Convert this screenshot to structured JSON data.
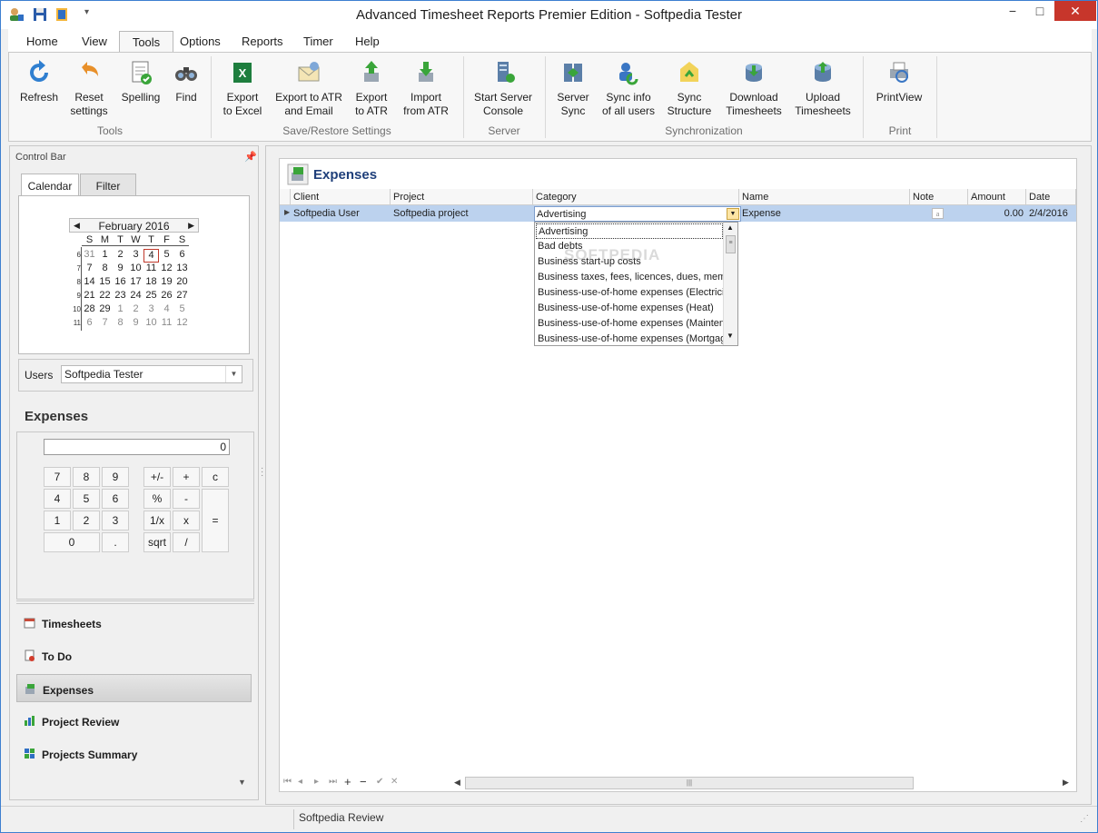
{
  "window": {
    "title": "Advanced Timesheet Reports Premier Edition - Softpedia Tester",
    "minimize": "−",
    "maximize": "□",
    "close": "✕",
    "qat_menu": "▾"
  },
  "menu": {
    "tabs": [
      "Home",
      "View",
      "Tools",
      "Options",
      "Reports",
      "Timer",
      "Help"
    ],
    "active": "Tools"
  },
  "ribbon": {
    "buttons": [
      {
        "id": "refresh",
        "label": "Refresh",
        "icon": "refresh-icon"
      },
      {
        "id": "reset",
        "label": "Reset settings",
        "icon": "undo-icon"
      },
      {
        "id": "spelling",
        "label": "Spelling",
        "icon": "spellcheck-icon"
      },
      {
        "id": "find",
        "label": "Find",
        "icon": "binoculars-icon"
      },
      {
        "id": "export_excel",
        "label": "Export to Excel",
        "icon": "excel-icon"
      },
      {
        "id": "export_atr_email",
        "label": "Export to ATR and Email",
        "icon": "email-icon"
      },
      {
        "id": "export_atr",
        "label": "Export to ATR",
        "icon": "export-icon"
      },
      {
        "id": "import_atr",
        "label": "Import from ATR",
        "icon": "import-icon"
      },
      {
        "id": "start_server",
        "label": "Start Server Console",
        "icon": "server-icon"
      },
      {
        "id": "server_sync",
        "label": "Server Sync",
        "icon": "sync-icon"
      },
      {
        "id": "sync_users",
        "label": "Sync info of all users",
        "icon": "users-sync-icon"
      },
      {
        "id": "sync_structure",
        "label": "Sync Structure",
        "icon": "structure-icon"
      },
      {
        "id": "download_ts",
        "label": "Download Timesheets",
        "icon": "download-icon"
      },
      {
        "id": "upload_ts",
        "label": "Upload Timesheets",
        "icon": "upload-icon"
      },
      {
        "id": "printview",
        "label": "PrintView",
        "icon": "print-preview-icon"
      }
    ],
    "groups": [
      "Tools",
      "Save/Restore Settings",
      "Server",
      "Synchronization",
      "Print"
    ]
  },
  "control_bar": {
    "title": "Control Bar",
    "tabs": [
      "Calendar",
      "Filter"
    ],
    "calendar": {
      "month": "February 2016",
      "dow": [
        "S",
        "M",
        "T",
        "W",
        "T",
        "F",
        "S"
      ],
      "weeks": [
        {
          "wk": "6",
          "days": [
            "31",
            "1",
            "2",
            "3",
            "4",
            "5",
            "6"
          ]
        },
        {
          "wk": "7",
          "days": [
            "7",
            "8",
            "9",
            "10",
            "11",
            "12",
            "13"
          ]
        },
        {
          "wk": "8",
          "days": [
            "14",
            "15",
            "16",
            "17",
            "18",
            "19",
            "20"
          ]
        },
        {
          "wk": "9",
          "days": [
            "21",
            "22",
            "23",
            "24",
            "25",
            "26",
            "27"
          ]
        },
        {
          "wk": "10",
          "days": [
            "28",
            "29",
            "1",
            "2",
            "3",
            "4",
            "5"
          ]
        },
        {
          "wk": "11",
          "days": [
            "6",
            "7",
            "8",
            "9",
            "10",
            "11",
            "12"
          ]
        }
      ],
      "today": "4"
    },
    "users_label": "Users",
    "users_value": "Softpedia Tester",
    "section_title": "Expenses",
    "calc": {
      "display": "0",
      "keys": {
        "k7": "7",
        "k8": "8",
        "k9": "9",
        "k4": "4",
        "k5": "5",
        "k6": "6",
        "k1": "1",
        "k2": "2",
        "k3": "3",
        "k0": "0",
        "kdot": ".",
        "kpm": "+/-",
        "kplus": "+",
        "kc": "c",
        "kpct": "%",
        "kminus": "-",
        "kinv": "1/x",
        "kmul": "x",
        "keq": "=",
        "ksqrt": "sqrt",
        "kdiv": "/"
      }
    },
    "nav": [
      "Timesheets",
      "To Do",
      "Expenses",
      "Project Review",
      "Projects Summary"
    ],
    "nav_active": "Expenses"
  },
  "grid": {
    "title": "Expenses",
    "columns": [
      "Client",
      "Project",
      "Category",
      "Name",
      "Note",
      "Amount",
      "Date"
    ],
    "row": {
      "client": "Softpedia User",
      "project": "Softpedia project",
      "category": "Advertising",
      "name": "Expense",
      "amount": "0.00",
      "date": "2/4/2016"
    },
    "dropdown": [
      "Advertising",
      "Bad debts",
      "Business start-up costs",
      "Business taxes, fees, licences, dues, mem",
      "Business-use-of-home expenses (Electricit",
      "Business-use-of-home expenses (Heat)",
      "Business-use-of-home expenses (Mainten",
      "Business-use-of-home expenses (Mortgag"
    ],
    "watermark": "SOFTPEDIA"
  },
  "status": {
    "text": "Softpedia Review"
  }
}
